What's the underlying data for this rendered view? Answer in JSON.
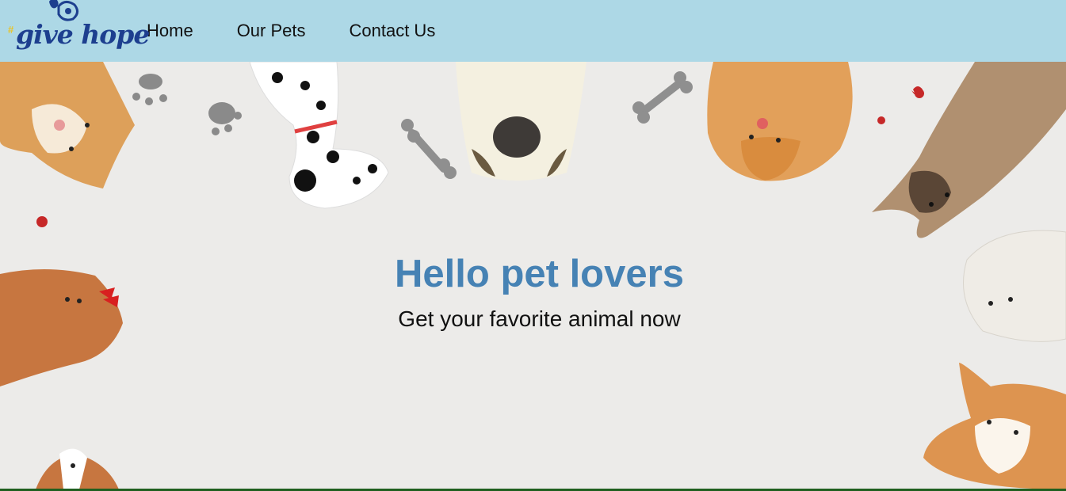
{
  "header": {
    "logo": {
      "hash": "#",
      "text": "give hope"
    },
    "nav": [
      {
        "label": "Home"
      },
      {
        "label": "Our Pets"
      },
      {
        "label": "Contact Us"
      }
    ]
  },
  "hero": {
    "title": "Hello pet lovers",
    "subtitle": "Get your favorite animal now"
  },
  "colors": {
    "navbar": "#add8e6",
    "title": "#4682b4",
    "background": "#ecebe9",
    "logo": "#1d3f8f"
  }
}
